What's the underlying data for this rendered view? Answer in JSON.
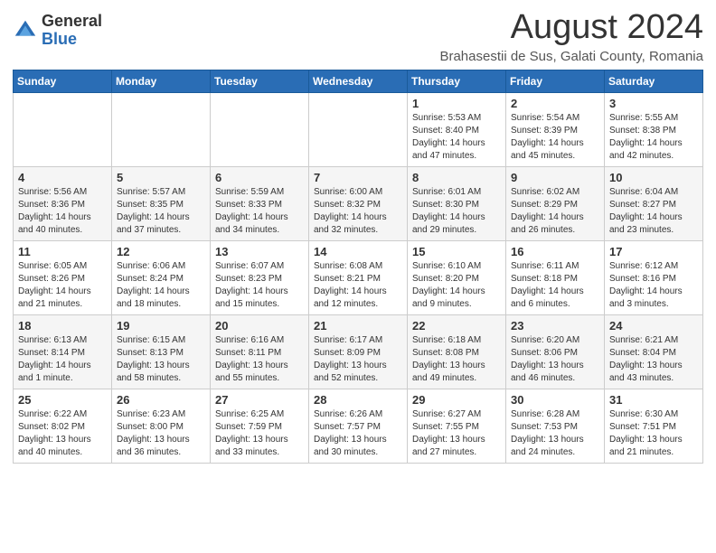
{
  "logo": {
    "general": "General",
    "blue": "Blue"
  },
  "title": "August 2024",
  "subtitle": "Brahasestii de Sus, Galati County, Romania",
  "days_of_week": [
    "Sunday",
    "Monday",
    "Tuesday",
    "Wednesday",
    "Thursday",
    "Friday",
    "Saturday"
  ],
  "weeks": [
    [
      {
        "day": "",
        "info": ""
      },
      {
        "day": "",
        "info": ""
      },
      {
        "day": "",
        "info": ""
      },
      {
        "day": "",
        "info": ""
      },
      {
        "day": "1",
        "info": "Sunrise: 5:53 AM\nSunset: 8:40 PM\nDaylight: 14 hours and 47 minutes."
      },
      {
        "day": "2",
        "info": "Sunrise: 5:54 AM\nSunset: 8:39 PM\nDaylight: 14 hours and 45 minutes."
      },
      {
        "day": "3",
        "info": "Sunrise: 5:55 AM\nSunset: 8:38 PM\nDaylight: 14 hours and 42 minutes."
      }
    ],
    [
      {
        "day": "4",
        "info": "Sunrise: 5:56 AM\nSunset: 8:36 PM\nDaylight: 14 hours and 40 minutes."
      },
      {
        "day": "5",
        "info": "Sunrise: 5:57 AM\nSunset: 8:35 PM\nDaylight: 14 hours and 37 minutes."
      },
      {
        "day": "6",
        "info": "Sunrise: 5:59 AM\nSunset: 8:33 PM\nDaylight: 14 hours and 34 minutes."
      },
      {
        "day": "7",
        "info": "Sunrise: 6:00 AM\nSunset: 8:32 PM\nDaylight: 14 hours and 32 minutes."
      },
      {
        "day": "8",
        "info": "Sunrise: 6:01 AM\nSunset: 8:30 PM\nDaylight: 14 hours and 29 minutes."
      },
      {
        "day": "9",
        "info": "Sunrise: 6:02 AM\nSunset: 8:29 PM\nDaylight: 14 hours and 26 minutes."
      },
      {
        "day": "10",
        "info": "Sunrise: 6:04 AM\nSunset: 8:27 PM\nDaylight: 14 hours and 23 minutes."
      }
    ],
    [
      {
        "day": "11",
        "info": "Sunrise: 6:05 AM\nSunset: 8:26 PM\nDaylight: 14 hours and 21 minutes."
      },
      {
        "day": "12",
        "info": "Sunrise: 6:06 AM\nSunset: 8:24 PM\nDaylight: 14 hours and 18 minutes."
      },
      {
        "day": "13",
        "info": "Sunrise: 6:07 AM\nSunset: 8:23 PM\nDaylight: 14 hours and 15 minutes."
      },
      {
        "day": "14",
        "info": "Sunrise: 6:08 AM\nSunset: 8:21 PM\nDaylight: 14 hours and 12 minutes."
      },
      {
        "day": "15",
        "info": "Sunrise: 6:10 AM\nSunset: 8:20 PM\nDaylight: 14 hours and 9 minutes."
      },
      {
        "day": "16",
        "info": "Sunrise: 6:11 AM\nSunset: 8:18 PM\nDaylight: 14 hours and 6 minutes."
      },
      {
        "day": "17",
        "info": "Sunrise: 6:12 AM\nSunset: 8:16 PM\nDaylight: 14 hours and 3 minutes."
      }
    ],
    [
      {
        "day": "18",
        "info": "Sunrise: 6:13 AM\nSunset: 8:14 PM\nDaylight: 14 hours and 1 minute."
      },
      {
        "day": "19",
        "info": "Sunrise: 6:15 AM\nSunset: 8:13 PM\nDaylight: 13 hours and 58 minutes."
      },
      {
        "day": "20",
        "info": "Sunrise: 6:16 AM\nSunset: 8:11 PM\nDaylight: 13 hours and 55 minutes."
      },
      {
        "day": "21",
        "info": "Sunrise: 6:17 AM\nSunset: 8:09 PM\nDaylight: 13 hours and 52 minutes."
      },
      {
        "day": "22",
        "info": "Sunrise: 6:18 AM\nSunset: 8:08 PM\nDaylight: 13 hours and 49 minutes."
      },
      {
        "day": "23",
        "info": "Sunrise: 6:20 AM\nSunset: 8:06 PM\nDaylight: 13 hours and 46 minutes."
      },
      {
        "day": "24",
        "info": "Sunrise: 6:21 AM\nSunset: 8:04 PM\nDaylight: 13 hours and 43 minutes."
      }
    ],
    [
      {
        "day": "25",
        "info": "Sunrise: 6:22 AM\nSunset: 8:02 PM\nDaylight: 13 hours and 40 minutes."
      },
      {
        "day": "26",
        "info": "Sunrise: 6:23 AM\nSunset: 8:00 PM\nDaylight: 13 hours and 36 minutes."
      },
      {
        "day": "27",
        "info": "Sunrise: 6:25 AM\nSunset: 7:59 PM\nDaylight: 13 hours and 33 minutes."
      },
      {
        "day": "28",
        "info": "Sunrise: 6:26 AM\nSunset: 7:57 PM\nDaylight: 13 hours and 30 minutes."
      },
      {
        "day": "29",
        "info": "Sunrise: 6:27 AM\nSunset: 7:55 PM\nDaylight: 13 hours and 27 minutes."
      },
      {
        "day": "30",
        "info": "Sunrise: 6:28 AM\nSunset: 7:53 PM\nDaylight: 13 hours and 24 minutes."
      },
      {
        "day": "31",
        "info": "Sunrise: 6:30 AM\nSunset: 7:51 PM\nDaylight: 13 hours and 21 minutes."
      }
    ]
  ]
}
